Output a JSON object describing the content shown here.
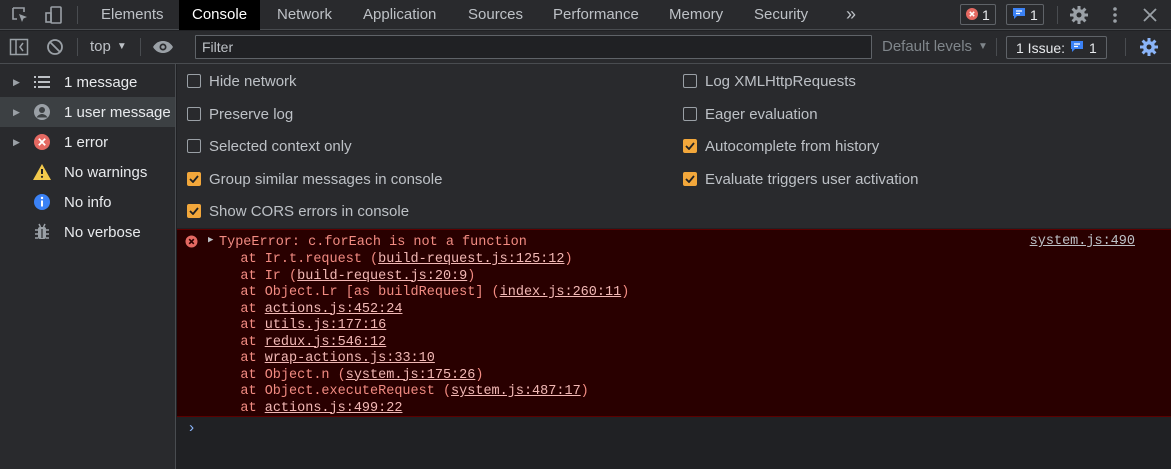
{
  "tabs": [
    "Elements",
    "Console",
    "Network",
    "Application",
    "Sources",
    "Performance",
    "Memory",
    "Security"
  ],
  "more_tabs_glyph": "»",
  "badges": {
    "errors": "1",
    "messages": "1"
  },
  "toolbar": {
    "context": "top",
    "filter_placeholder": "Filter",
    "levels": "Default levels",
    "issues_label": "1 Issue:",
    "issues_count": "1"
  },
  "sidebar": {
    "items": [
      {
        "label": "1 message",
        "icon": "list-icon"
      },
      {
        "label": "1 user message",
        "icon": "user-icon"
      },
      {
        "label": "1 error",
        "icon": "error-icon"
      },
      {
        "label": "No warnings",
        "icon": "warning-icon"
      },
      {
        "label": "No info",
        "icon": "info-icon"
      },
      {
        "label": "No verbose",
        "icon": "bug-icon"
      }
    ]
  },
  "settings": {
    "left": [
      {
        "label": "Hide network",
        "checked": false
      },
      {
        "label": "Preserve log",
        "checked": false
      },
      {
        "label": "Selected context only",
        "checked": false
      },
      {
        "label": "Group similar messages in console",
        "checked": true
      },
      {
        "label": "Show CORS errors in console",
        "checked": true
      }
    ],
    "right": [
      {
        "label": "Log XMLHttpRequests",
        "checked": false
      },
      {
        "label": "Eager evaluation",
        "checked": false
      },
      {
        "label": "Autocomplete from history",
        "checked": true
      },
      {
        "label": "Evaluate triggers user activation",
        "checked": true
      }
    ]
  },
  "error": {
    "message": "TypeError: c.forEach is not a function",
    "source": "system.js:490",
    "stack": [
      {
        "prefix": "    at Ir.t.request (",
        "link": "build-request.js:125:12",
        "suffix": ")"
      },
      {
        "prefix": "    at Ir (",
        "link": "build-request.js:20:9",
        "suffix": ")"
      },
      {
        "prefix": "    at Object.Lr [as buildRequest] (",
        "link": "index.js:260:11",
        "suffix": ")"
      },
      {
        "prefix": "    at ",
        "link": "actions.js:452:24",
        "suffix": ""
      },
      {
        "prefix": "    at ",
        "link": "utils.js:177:16",
        "suffix": ""
      },
      {
        "prefix": "    at ",
        "link": "redux.js:546:12",
        "suffix": ""
      },
      {
        "prefix": "    at ",
        "link": "wrap-actions.js:33:10",
        "suffix": ""
      },
      {
        "prefix": "    at Object.n (",
        "link": "system.js:175:26",
        "suffix": ")"
      },
      {
        "prefix": "    at Object.executeRequest (",
        "link": "system.js:487:17",
        "suffix": ")"
      },
      {
        "prefix": "    at ",
        "link": "actions.js:499:22",
        "suffix": ""
      }
    ]
  },
  "colors": {
    "error_bg": "#290000",
    "error_text": "#f28b82",
    "checkbox_on": "#f2a73b",
    "accent_blue": "#8ab4f8"
  }
}
